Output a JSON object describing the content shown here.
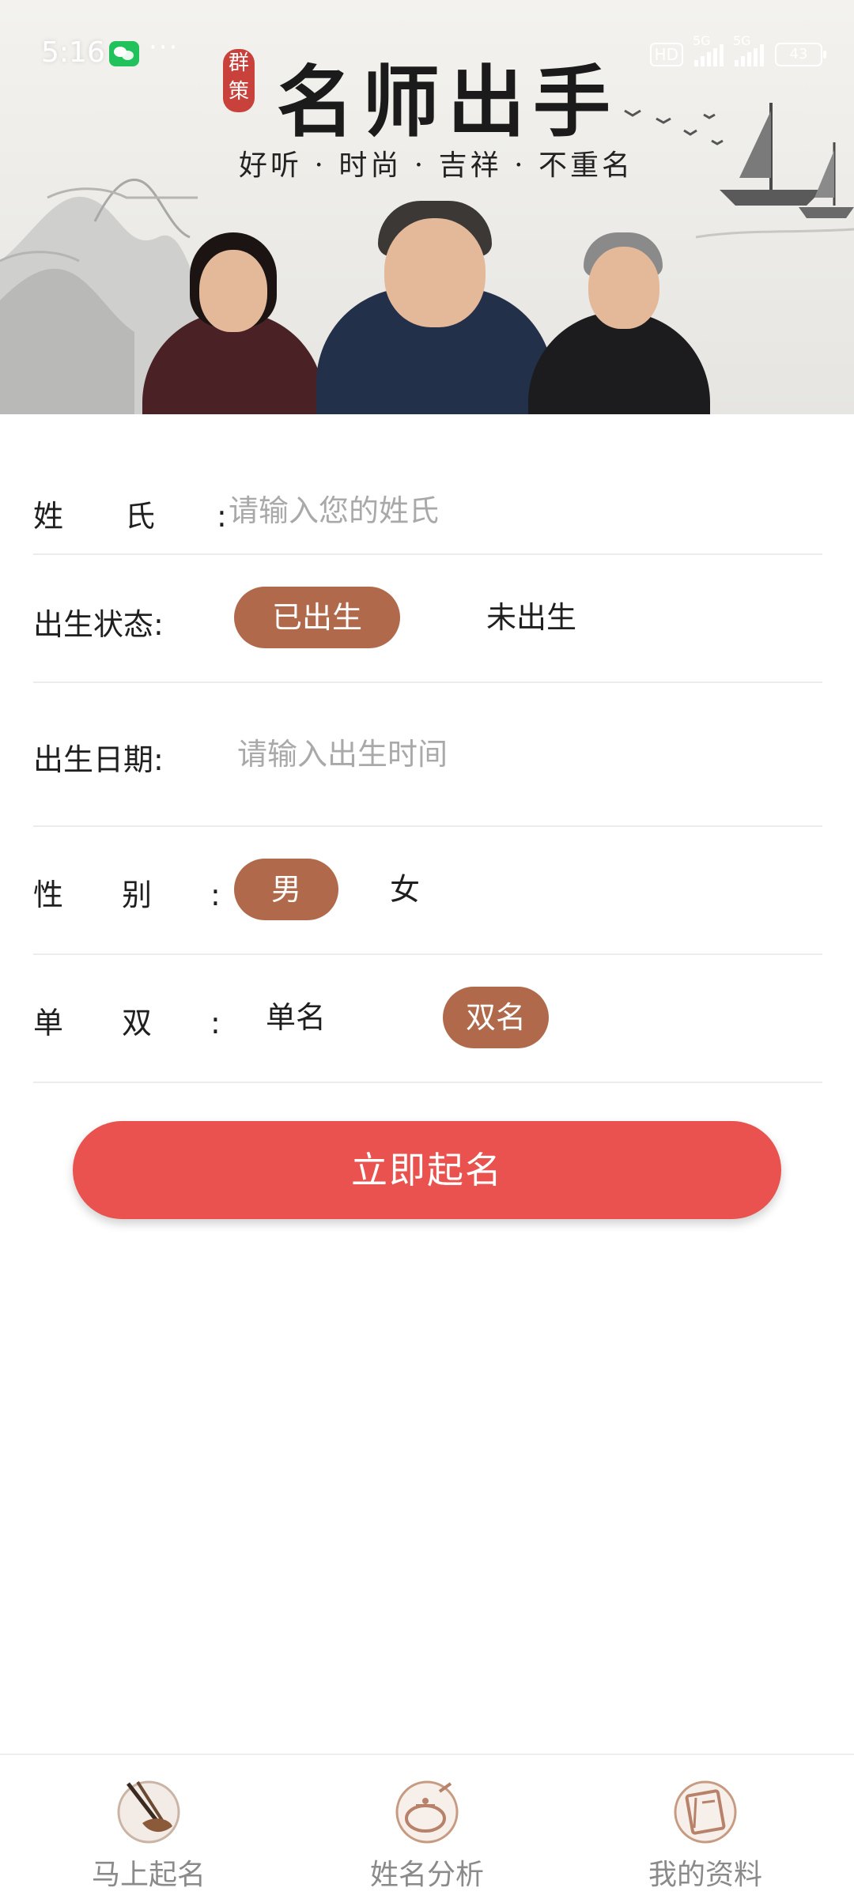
{
  "status_bar": {
    "time": "5:16",
    "more": "···",
    "hd": "HD",
    "sim1": "5G",
    "sim2": "5G",
    "battery": "43"
  },
  "banner": {
    "seal_text": "群策",
    "title": "名师出手",
    "subtitle": "好听 · 时尚 · 吉祥 · 不重名"
  },
  "form": {
    "surname": {
      "label": "姓氏:",
      "placeholder": "请输入您的姓氏",
      "value": ""
    },
    "birth_status": {
      "label": "出生状态:",
      "options": [
        "已出生",
        "未出生"
      ],
      "selected": "已出生"
    },
    "birth_date": {
      "label": "出生日期:",
      "placeholder": "请输入出生时间",
      "value": ""
    },
    "gender": {
      "label": "性别:",
      "options": [
        "男",
        "女"
      ],
      "selected": "男"
    },
    "name_length": {
      "label": "单双:",
      "options": [
        "单名",
        "双名"
      ],
      "selected": "双名"
    },
    "submit_label": "立即起名"
  },
  "tabbar": {
    "items": [
      {
        "label": "马上起名",
        "icon": "brush-icon"
      },
      {
        "label": "姓名分析",
        "icon": "teapot-icon"
      },
      {
        "label": "我的资料",
        "icon": "book-icon"
      }
    ]
  },
  "colors": {
    "accent_brown": "#b06a4b",
    "submit_red": "#e9524e",
    "seal_red": "#c8413a"
  }
}
